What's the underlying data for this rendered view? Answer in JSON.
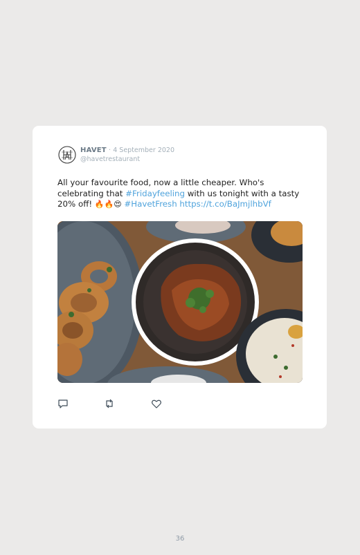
{
  "tweet": {
    "author_name": "HAVET",
    "separator": "·",
    "date": "4 September 2020",
    "handle": "@havetrestaurant",
    "text_1": "All your favourite food, now a little cheaper. Who's celebrating that ",
    "hashtag_1": "#Fridayfeeling",
    "text_2": " with us tonight with a tasty 20% off! ",
    "emojis": "🔥🔥😍",
    "text_3": " ",
    "hashtag_2": "#HavetFresh",
    "text_4": " ",
    "url": "https://t.co/BaJmjlhbVf"
  },
  "actions": {
    "reply_icon": "reply-icon",
    "retweet_icon": "retweet-icon",
    "like_icon": "like-icon"
  },
  "page": {
    "number": "36"
  },
  "colors": {
    "background": "#ebeae9",
    "card": "#ffffff",
    "link": "#4fa3dc",
    "muted": "#a4b0b9"
  }
}
